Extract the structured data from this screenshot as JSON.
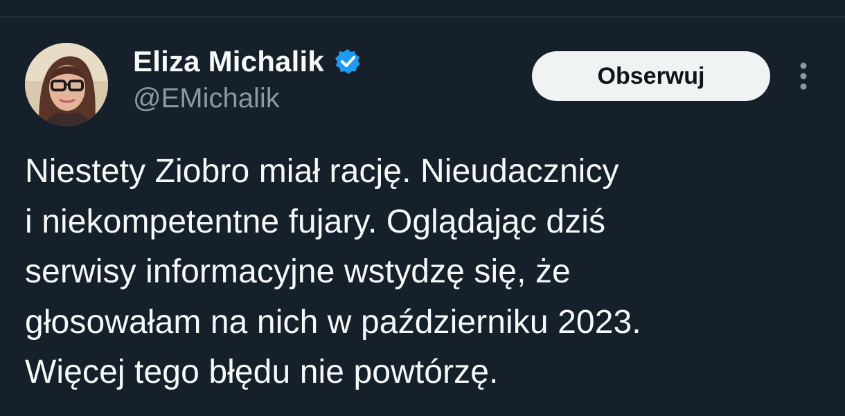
{
  "tweet": {
    "author": {
      "display_name": "Eliza Michalik",
      "handle": "@EMichalik",
      "verified": true,
      "verified_color": "#1d9bf0"
    },
    "follow_label": "Obserwuj",
    "more_icon": "three-dots-vertical-icon",
    "text_lines": [
      "Niestety Ziobro miał rację. Nieudacznicy",
      "i niekompetentne fujary. Oglądając dziś",
      "serwisy informacyjne wstydzę się, że",
      "głosowałam na nich w październiku 2023.",
      "Więcej tego błędu nie powtórzę."
    ]
  },
  "theme": {
    "background": "#15202b",
    "text": "#f7f9f9",
    "secondary_text": "#8b98a5",
    "button_background": "#eff3f4",
    "button_text": "#0f1419"
  }
}
